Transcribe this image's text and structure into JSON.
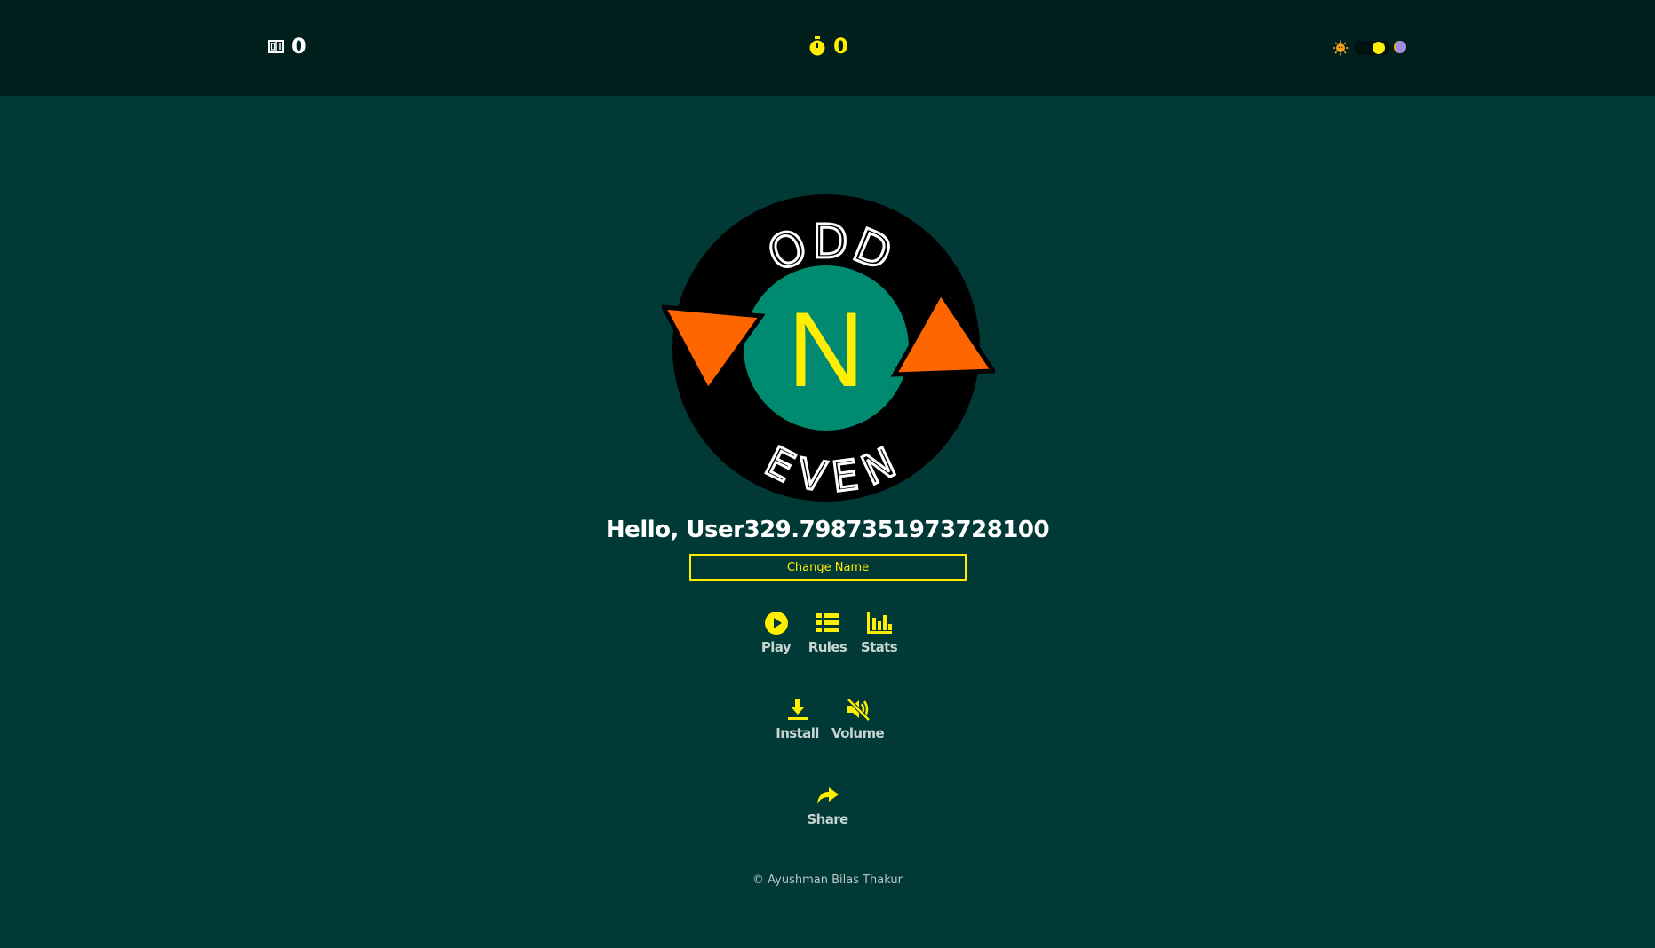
{
  "header": {
    "score_value": "0",
    "timer_value": "0",
    "theme_toggle": {
      "left_icon": "sun-icon",
      "right_icon": "moon-icon",
      "knob_color": "#ffee00"
    }
  },
  "logo": {
    "top_word": "ODD",
    "center_letter": "N",
    "bottom_word": "EVEN"
  },
  "greeting": "Hello, User329.7987351973728100",
  "change_name_label": "Change Name",
  "menu": {
    "play": "Play",
    "rules": "Rules",
    "stats": "Stats",
    "install": "Install",
    "volume": "Volume",
    "share": "Share"
  },
  "footer": "© Ayushman Bilas Thakur",
  "colors": {
    "background": "#003936",
    "topbar": "#001f1d",
    "accent": "#ffee00",
    "arrow": "#ff6600",
    "inner_circle": "#008a70"
  }
}
